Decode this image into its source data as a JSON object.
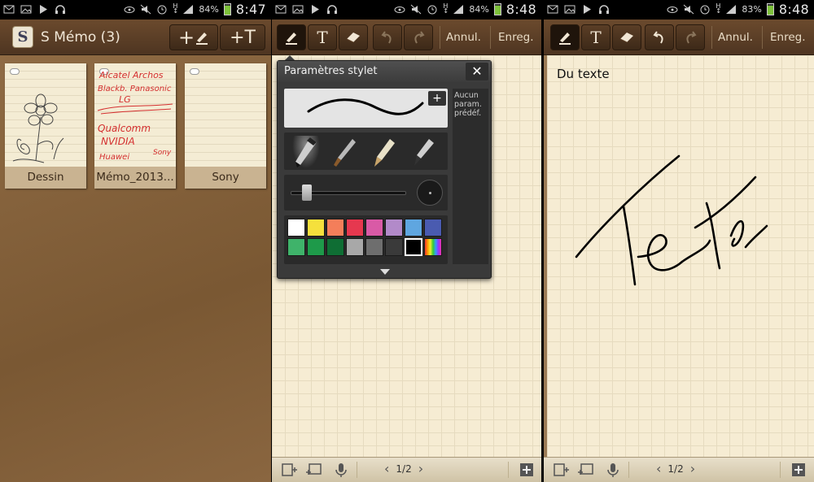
{
  "status_bars": [
    {
      "battery": "84%",
      "time": "8:47"
    },
    {
      "battery": "84%",
      "time": "8:48"
    },
    {
      "battery": "83%",
      "time": "8:48"
    }
  ],
  "list_screen": {
    "app_title": "S Mémo (3)",
    "app_icon_letter": "S",
    "new_handwriting": "+",
    "new_text": "+T",
    "memos": [
      {
        "title": "Dessin"
      },
      {
        "title": "Mémo_2013..."
      },
      {
        "title": "Sony"
      }
    ],
    "memo2_scribbles": [
      "Alcatel Archos",
      "Blackb. Panasonic",
      "LG",
      "Qualcomm",
      "NVIDIA",
      "Huawei",
      "Sony"
    ]
  },
  "editor": {
    "undo_label": "Annul.",
    "save_label": "Enreg.",
    "page_indicator": "1/2",
    "note_text": "Du texte"
  },
  "stylus_panel": {
    "title": "Paramètres stylet",
    "close": "✕",
    "add": "+",
    "presets_text": "Aucun param. prédéf.",
    "pen_types": [
      "marker",
      "brush",
      "pencil",
      "calligraphy-pen"
    ],
    "selected_pen": "marker",
    "size_level": 0.1,
    "colors_row1": [
      "#ffffff",
      "#f5e03c",
      "#f47e5a",
      "#e6384f",
      "#d95aa6",
      "#b28ac9",
      "#5fa6e0",
      "#4a5bb0"
    ],
    "colors_row2": [
      "#3fb36a",
      "#1e9a4a",
      "#0f6e34",
      "#a8a8a8",
      "#6e6e6e",
      "#3a3a3a",
      "#000000",
      "rainbow"
    ],
    "selected_color": "#000000"
  }
}
